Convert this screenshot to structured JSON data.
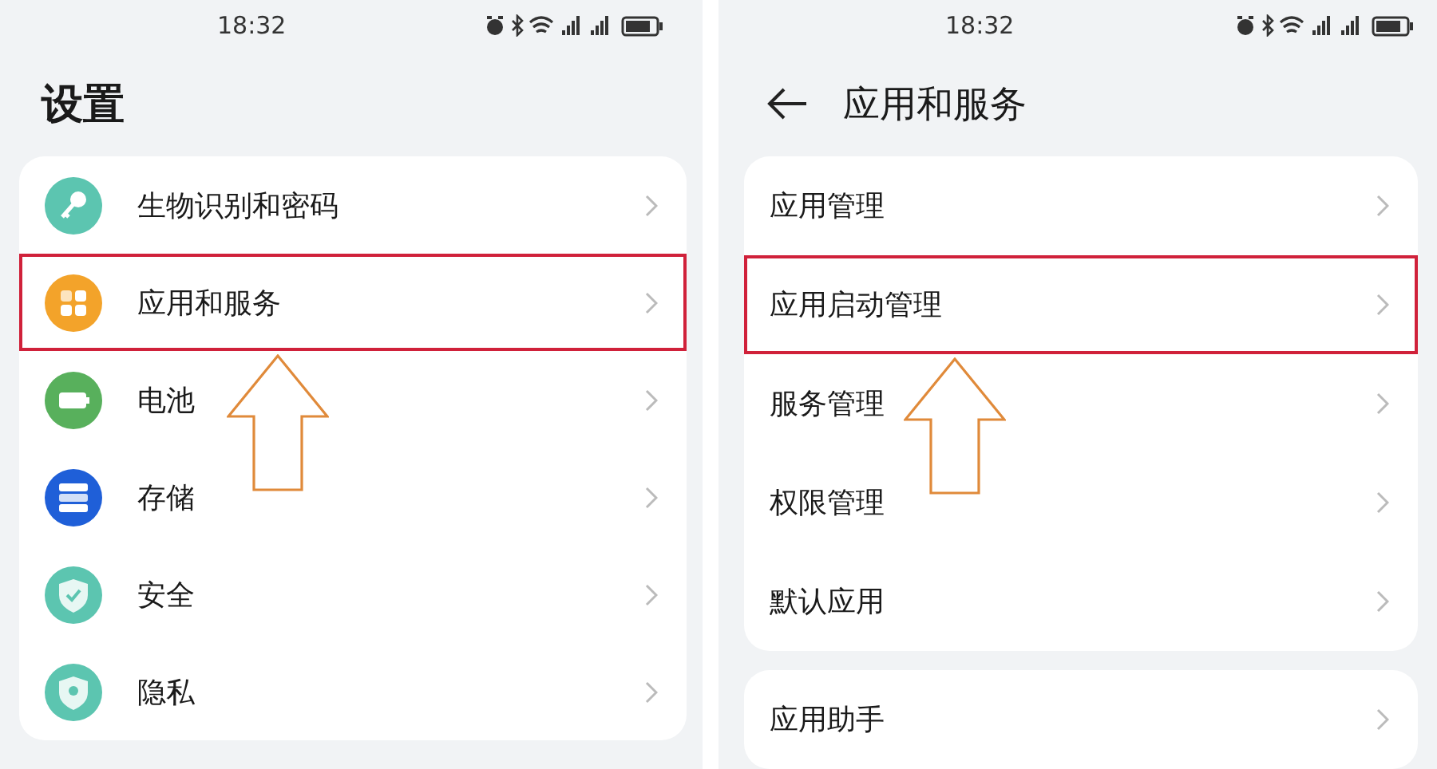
{
  "panels": [
    {
      "status_time": "18:32",
      "back": false,
      "title": "设置",
      "groups": [
        {
          "items": [
            {
              "label": "生物识别和密码",
              "kind": "key",
              "highlighted": false
            },
            {
              "label": "应用和服务",
              "kind": "apps",
              "highlighted": true
            },
            {
              "label": "电池",
              "kind": "battery",
              "highlighted": false
            },
            {
              "label": "存储",
              "kind": "storage",
              "highlighted": false
            },
            {
              "label": "安全",
              "kind": "shield",
              "highlighted": false
            },
            {
              "label": "隐私",
              "kind": "privacy",
              "highlighted": false
            }
          ]
        }
      ]
    },
    {
      "status_time": "18:32",
      "back": true,
      "title": "应用和服务",
      "groups": [
        {
          "items": [
            {
              "label": "应用管理",
              "highlighted": false
            },
            {
              "label": "应用启动管理",
              "highlighted": true
            },
            {
              "label": "服务管理",
              "highlighted": false
            },
            {
              "label": "权限管理",
              "highlighted": false
            },
            {
              "label": "默认应用",
              "highlighted": false
            }
          ]
        },
        {
          "items": [
            {
              "label": "应用助手",
              "highlighted": false
            }
          ]
        }
      ]
    }
  ]
}
